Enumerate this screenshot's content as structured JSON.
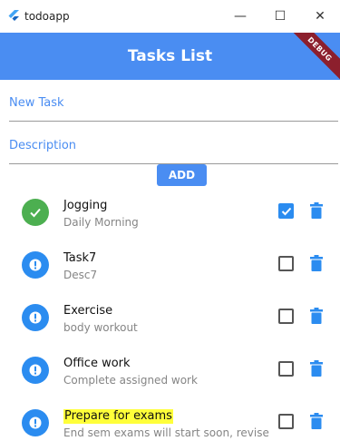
{
  "window": {
    "title": "todoapp",
    "controls": {
      "minimize": "—",
      "maximize": "☐",
      "close": "✕"
    }
  },
  "appbar": {
    "title": "Tasks List",
    "debug_label": "DEBUG"
  },
  "form": {
    "task_placeholder": "New Task",
    "desc_placeholder": "Description",
    "add_label": "ADD"
  },
  "tasks": [
    {
      "title": "Jogging",
      "description": "Daily Morning",
      "done": true
    },
    {
      "title": "Task7",
      "description": "Desc7",
      "done": false
    },
    {
      "title": "Exercise",
      "description": "body workout",
      "done": false
    },
    {
      "title": "Office work",
      "description": "Complete assigned work",
      "done": false
    },
    {
      "title": "Prepare for exams",
      "description": "End sem exams will start soon, revise all modules",
      "done": false
    }
  ],
  "colors": {
    "accent": "#4a8df2",
    "done": "#4caf50",
    "pending": "#2b8cf0",
    "highlight": "#ffff3a"
  },
  "icons": {
    "done": "check-circle-icon",
    "pending": "exclamation-circle-icon",
    "delete": "trash-icon"
  }
}
